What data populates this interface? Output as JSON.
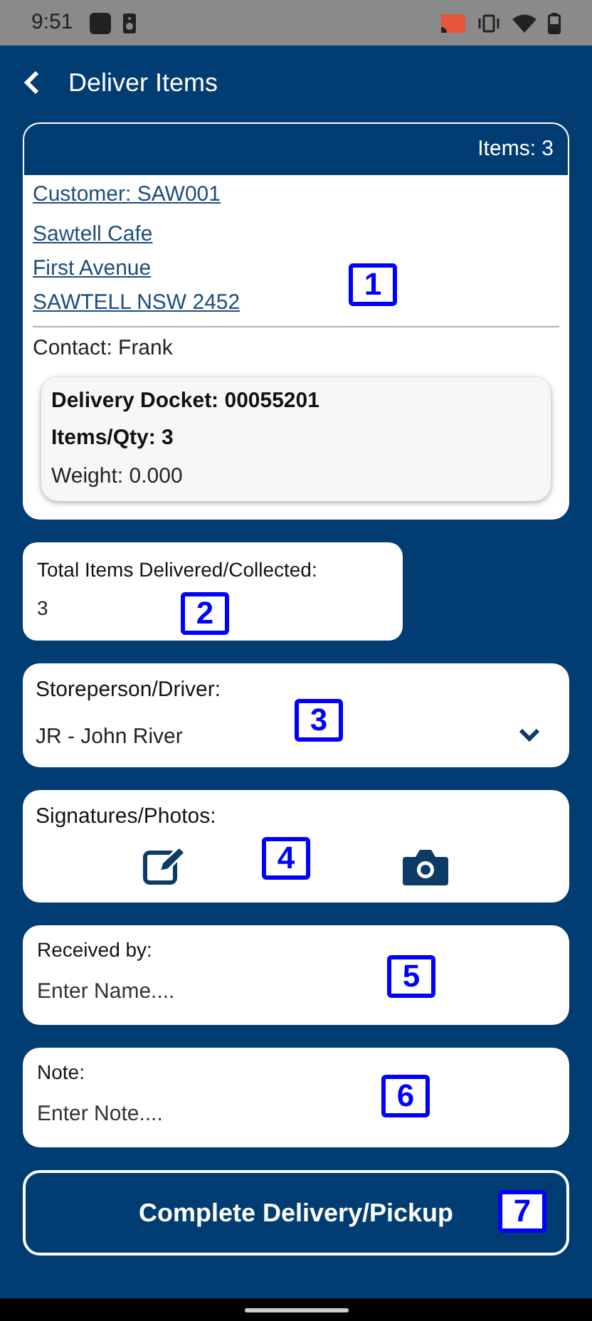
{
  "status_bar": {
    "time": "9:51"
  },
  "header": {
    "title": "Deliver Items"
  },
  "summary": {
    "marker": "1",
    "items_count": "Items: 3",
    "customer": "Customer: SAW001",
    "address_lines": [
      "Sawtell Cafe",
      "First Avenue",
      "SAWTELL NSW 2452"
    ],
    "contact": "Contact: Frank",
    "docket": {
      "number": "Delivery Docket: 00055201",
      "qty": "Items/Qty: 3",
      "weight": "Weight: 0.000"
    }
  },
  "total_items": {
    "marker": "2",
    "label": "Total Items Delivered/Collected:",
    "value": "3"
  },
  "driver": {
    "marker": "3",
    "label": "Storeperson/Driver:",
    "value": "JR - John River"
  },
  "signatures": {
    "marker": "4",
    "label": "Signatures/Photos:"
  },
  "received_by": {
    "marker": "5",
    "label": "Received by:",
    "placeholder": "Enter Name...."
  },
  "note": {
    "marker": "6",
    "label": "Note:",
    "placeholder": "Enter Note...."
  },
  "complete_button": {
    "marker": "7",
    "label": "Complete Delivery/Pickup"
  }
}
